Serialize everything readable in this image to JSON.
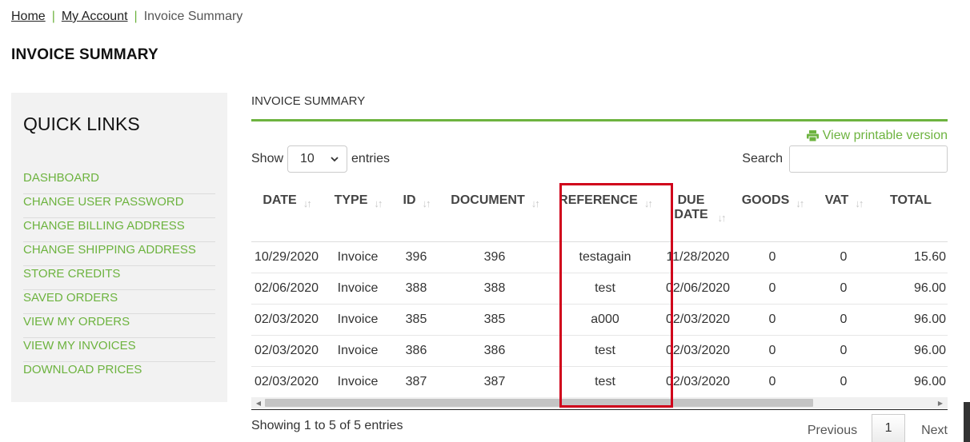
{
  "breadcrumb": {
    "home": "Home",
    "account": "My Account",
    "current": "Invoice Summary",
    "separator": "|"
  },
  "page_title": "INVOICE SUMMARY",
  "quick_links": {
    "title": "QUICK LINKS",
    "items": [
      "DASHBOARD",
      "CHANGE USER PASSWORD",
      "CHANGE BILLING ADDRESS",
      "CHANGE SHIPPING ADDRESS",
      "STORE CREDITS",
      "SAVED ORDERS",
      "VIEW MY ORDERS",
      "VIEW MY INVOICES",
      "DOWNLOAD PRICES"
    ]
  },
  "main": {
    "title": "INVOICE SUMMARY",
    "printable_label": "View printable version",
    "show_label": "Show",
    "entries_value": "10",
    "entries_label": "entries",
    "search_label": "Search",
    "search_value": ""
  },
  "table": {
    "headers": [
      "DATE",
      "TYPE",
      "ID",
      "DOCUMENT",
      "REFERENCE",
      "DUE DATE",
      "GOODS",
      "VAT",
      "TOTAL"
    ],
    "rows": [
      [
        "10/29/2020",
        "Invoice",
        "396",
        "396",
        "testagain",
        "11/28/2020",
        "0",
        "0",
        "15.60"
      ],
      [
        "02/06/2020",
        "Invoice",
        "388",
        "388",
        "test",
        "02/06/2020",
        "0",
        "0",
        "96.00"
      ],
      [
        "02/03/2020",
        "Invoice",
        "385",
        "385",
        "a000",
        "02/03/2020",
        "0",
        "0",
        "96.00"
      ],
      [
        "02/03/2020",
        "Invoice",
        "386",
        "386",
        "test",
        "02/03/2020",
        "0",
        "0",
        "96.00"
      ],
      [
        "02/03/2020",
        "Invoice",
        "387",
        "387",
        "test",
        "02/03/2020",
        "0",
        "0",
        "96.00"
      ]
    ]
  },
  "footer": {
    "info": "Showing 1 to 5 of 5 entries",
    "previous": "Previous",
    "page": "1",
    "next": "Next"
  },
  "colors": {
    "accent": "#6db33f",
    "highlight": "#d0021b"
  }
}
